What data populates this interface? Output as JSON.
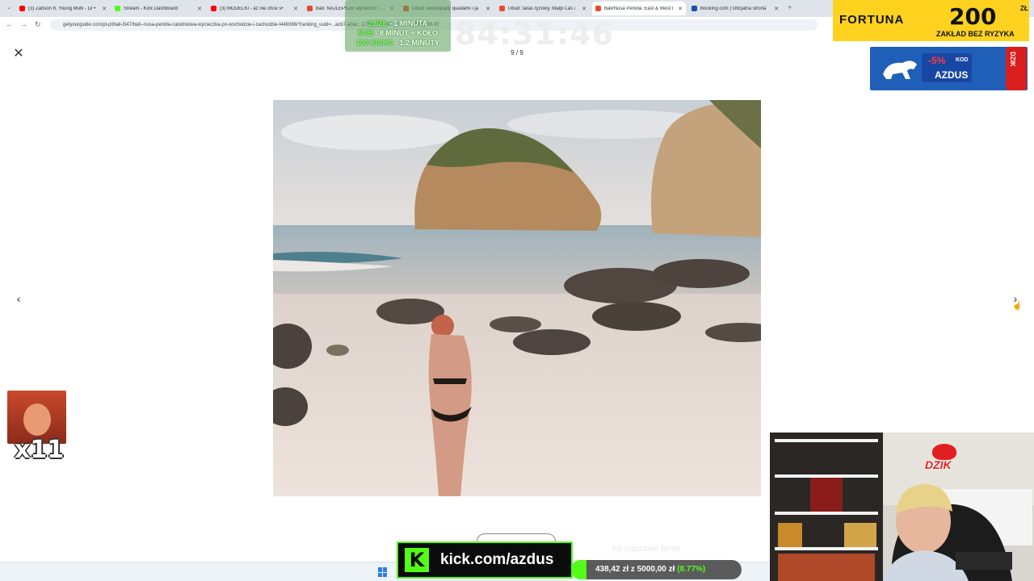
{
  "browser": {
    "tabs": [
      {
        "title": "(3) Zabson ft. Young Multi - D/ •",
        "favicon_color": "#ff0000",
        "active": false
      },
      {
        "title": "Stream - Kick Dashboard",
        "favicon_color": "#53fc18",
        "active": false
      },
      {
        "title": "(3) MODELKI - az nie chce s•",
        "favicon_color": "#ff0000",
        "active": false
      },
      {
        "title": "Bali: NAJLEPSZE wycieczki i atra",
        "favicon_color": "#e84a2f",
        "active": false
      },
      {
        "title": "Ubud: wodospady quadami i ja",
        "favicon_color": "#e84a2f",
        "active": false
      },
      {
        "title": "Ubud: taras ryzowy, Malpi Las i",
        "favicon_color": "#e84a2f",
        "active": false
      },
      {
        "title": "Bali/Nusa Penida: East & West I",
        "favicon_color": "#e84a2f",
        "active": true
      },
      {
        "title": "Booking.com | Oficjalna strona",
        "favicon_color": "#1a4fb4",
        "active": false
      }
    ],
    "new_tab_icon": "+",
    "url": "getyourguide.com/pl-pl/bali-l347/bali--nusa-penida-calodniowa-wycieczka-po-wschodzie-i-zachodzie-t449366/?ranking_uuid=...acb7-a0ac...1737...b...02F...7...date=2026-08-30"
  },
  "gallery": {
    "counter": "9 / 9",
    "close_icon": "✕",
    "prev_icon": "‹",
    "next_icon": "›"
  },
  "overlay": {
    "sub_alert": {
      "line1_hl": "2,5ZŁ",
      "line1": " - 1 MINUTA",
      "line2_hl": "SUB",
      "line2": " - 8 MINUT + KOŁO",
      "line3_hl": "100 KICKS",
      "line3": " - 1.2 MINUTY"
    },
    "timer": "84:31:46",
    "fortuna": {
      "brand": "FORTUNA",
      "amount": "200",
      "currency": "ZŁ",
      "subtitle": "ZAKŁAD BEZ RYZYKA"
    },
    "dzik_ad": {
      "percent": "-5%",
      "kod_label": "KOD",
      "code": "AZDUS",
      "can_text": "DZIK"
    },
    "emote_multiplier": "x11",
    "kick": {
      "logo_letter": "K",
      "text": "kick.com/azdus"
    },
    "caption": "na naprawe bmw",
    "goal": {
      "current": "438,42 zł",
      "separator": " z ",
      "target": "5000,00 zł",
      "percent_label": "(8.77%)",
      "percent": 8.77
    },
    "dzik_logo_text": "DZIK"
  }
}
